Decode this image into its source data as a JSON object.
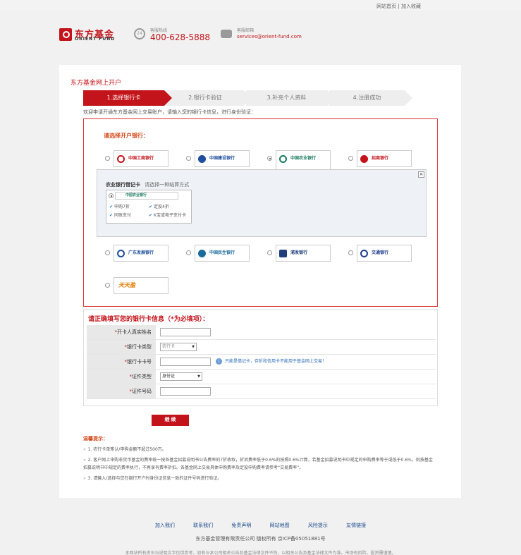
{
  "top_links": {
    "home": "网站首页",
    "sep": "|",
    "favorite": "加入收藏"
  },
  "brand": {
    "name_cn": "东方基金",
    "name_en": "ORIENT FUND"
  },
  "contact": {
    "hotline_label": "客服热线",
    "hotline_number": "400-628-5888",
    "email_label": "客服邮箱",
    "email": "services@orient-fund.com"
  },
  "page": {
    "title": "东方基金网上开户"
  },
  "steps": [
    {
      "label": "1.选择银行卡"
    },
    {
      "label": "2.银行卡验证"
    },
    {
      "label": "3.补充个人资料"
    },
    {
      "label": "4.注册成功"
    }
  ],
  "intro": "欢迎申请开通东方基金网上交易账户，请输入您的银行卡信息，进行身份验证：",
  "bank_select": {
    "prompt": "请选择开户银行：",
    "banks": [
      {
        "name": "中国工商银行",
        "color": "#c3141b"
      },
      {
        "name": "中国建设银行",
        "color": "#1f4e9a"
      },
      {
        "name": "中国农业银行",
        "color": "#1a7a5d",
        "selected": true
      },
      {
        "name": "招商银行",
        "color": "#c3141b"
      },
      {
        "name": "广东发展银行",
        "color": "#1f4e9a"
      },
      {
        "name": "中国民生银行",
        "color": "#1a6a9a"
      },
      {
        "name": "浦发银行",
        "color": "#1f3e7a"
      },
      {
        "name": "交通银行",
        "color": "#1f3e8a"
      },
      {
        "name": "天天盈",
        "color": "#e07b00"
      }
    ],
    "detail": {
      "card_name": "农业银行借记卡",
      "card_hint": "请选择一种结算方式",
      "card_logo": "中国农业银行",
      "features": [
        "申购7折",
        "定投4折",
        "同账支付",
        "K宝或电子支付卡"
      ]
    }
  },
  "info_form": {
    "title": "请正确填写您的银行卡信息（*为必填项）：",
    "required_mark": "*",
    "rows": [
      {
        "label": "开卡人真实姓名"
      },
      {
        "label": "银行卡类型",
        "select_value": "农行卡"
      },
      {
        "label": "银行卡卡号",
        "hint": "只能是借记卡，存折和信用卡不能用于基金网上交易！"
      },
      {
        "label": "证件类型",
        "select_value": "身份证"
      },
      {
        "label": "证件号码"
      }
    ]
  },
  "next_button": "继 续",
  "tips": {
    "title": "温馨提示：",
    "chev": "»",
    "items": [
      "1. 农行卡单笔认/申购金额不超过500万。",
      "2. 客户网上申购非货币基金的费率统一按各基金招募说明书公告费率的7折收取，折后费率低于0.6%的按照0.6%计算，若基金招募说明书中规定的申购费率等于或低于0.6%，则按基金招募说明书中规定的费率执行，不再享有费率折扣。各基金网上交易具体申购费率及定投申购费率请参考“交易费率”。",
      "3. 请输入/选择与您在银行开户时身份证信息一致的证件号码进行验证。"
    ]
  },
  "footer": {
    "links": [
      "加入我们",
      "联系我们",
      "免责声明",
      "网站地图",
      "风险提示",
      "友情链接"
    ],
    "copyright": "东方基金管理有限责任公司 版权所有 京ICP备05051881号",
    "disclaimer": "本网站所有资讯与说明文字仅供参考，如有与本公司相关公告及基金法律文件不符，以相关公告及基金法律文件为准。市场有风险，投资需谨慎。"
  },
  "colors": {
    "brand_red": "#c3141b",
    "link_blue": "#1a4a8a"
  }
}
